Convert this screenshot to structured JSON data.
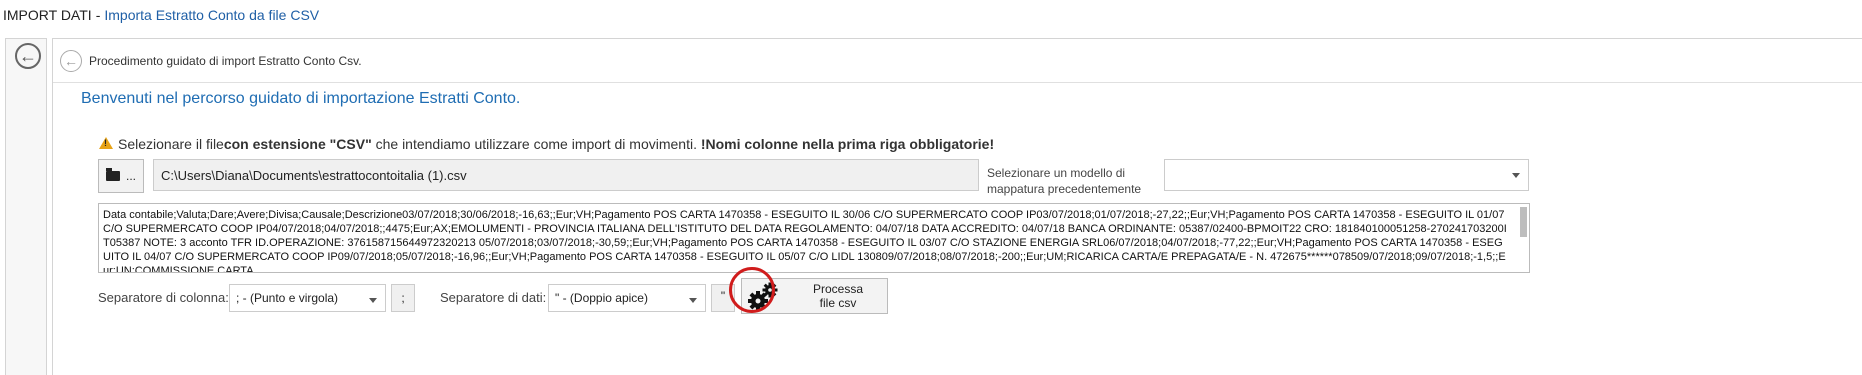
{
  "title_bar": {
    "main": "IMPORT DATI",
    "separator": "-",
    "sub": "Importa Estratto Conto da file CSV"
  },
  "left_strip": {
    "back_icon": "arrow-left-circle-icon"
  },
  "header": {
    "back_icon": "arrow-left-circle-icon",
    "text": "Procedimento guidato di import Estratto Conto Csv."
  },
  "welcome": "Benvenuti nel percorso guidato di importazione Estratti Conto.",
  "hint": {
    "part1": "Selezionare il file ",
    "bold1": "con estensione \"CSV\"",
    "part2": " che intendiamo utilizzare come import di movimenti. ",
    "bold2": "!Nomi colonne nella prima riga obbligatorie!"
  },
  "file": {
    "browse_label": "...",
    "browse_icon": "folder-icon",
    "path": "C:\\Users\\Diana\\Documents\\estrattocontoitalia (1).csv"
  },
  "model": {
    "label": "Selezionare un modello di mappatura precedentemente",
    "value": ""
  },
  "preview_text": "Data contabile;Valuta;Dare;Avere;Divisa;Causale;Descrizione03/07/2018;30/06/2018;-16,63;;Eur;VH;Pagamento POS CARTA 1470358 -  ESEGUITO IL 30/06 C/O SUPERMERCATO COOP IP03/07/2018;01/07/2018;-27,22;;Eur;VH;Pagamento POS CARTA 1470358 -  ESEGUITO IL 01/07 C/O SUPERMERCATO COOP IP04/07/2018;04/07/2018;;4475;Eur;AX;EMOLUMENTI -  PROVINCIA ITALIANA DELL'ISTITUTO DEL DATA REGOLAMENTO: 04/07/18 DATA ACCREDITO: 04/07/18 BANCA ORDINANTE: 05387/02400-BPMOIT22 CRO: 181840100051258-270241703200IT05387 NOTE: 3 acconto TFR ID.OPERAZIONE: 376158715644972320213 05/07/2018;03/07/2018;-30,59;;Eur;VH;Pagamento POS CARTA 1470358 -  ESEGUITO IL 03/07 C/O STAZIONE ENERGIA SRL06/07/2018;04/07/2018;-77,22;;Eur;VH;Pagamento POS CARTA 1470358 -  ESEGUITO IL 04/07 C/O SUPERMERCATO COOP IP09/07/2018;05/07/2018;-16,96;;Eur;VH;Pagamento POS CARTA 1470358 -  ESEGUITO IL 05/07 C/O LIDL 130809/07/2018;08/07/2018;-200;;Eur;UM;RICARICA CARTA/E PREPAGATA/E -  N. 472675******078509/07/2018;09/07/2018;-1,5;;Eur;UN;COMMISSIONE CARTA",
  "column_separator": {
    "label": "Separatore di colonna:",
    "selected": "; - (Punto e virgola)",
    "value": ";"
  },
  "data_separator": {
    "label": "Separatore di dati:",
    "selected": "\" - (Doppio apice)",
    "value": "\""
  },
  "process_button": {
    "line1": "Processa",
    "line2": "file csv",
    "icon": "gears-icon"
  },
  "colors": {
    "accent_blue": "#1f6db3",
    "highlight_red": "#d01c1c",
    "warning": "#e8a317"
  }
}
